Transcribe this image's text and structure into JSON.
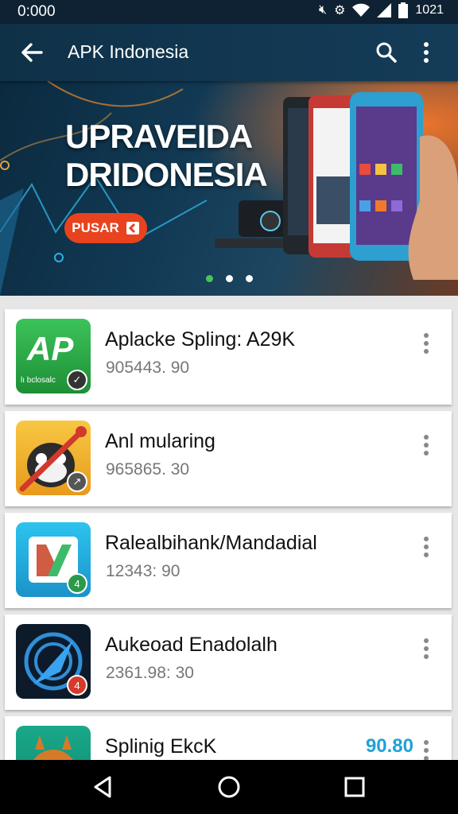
{
  "status_bar": {
    "time": "0:000",
    "icons": [
      "silent-icon",
      "settings-icon",
      "wifi-icon",
      "signal-icon",
      "battery-icon"
    ],
    "clock": "1021"
  },
  "app_bar": {
    "title": "APK Indonesia",
    "icons": [
      "back-arrow-icon",
      "search-icon",
      "more-vert-icon"
    ]
  },
  "banner": {
    "headline_line1": "UPRAVEIDA",
    "headline_line2": "DRIDONESIA",
    "cta_label": "PUSAR",
    "page_indicator": {
      "count": 3,
      "active": 1
    }
  },
  "apps": [
    {
      "name": "Aplacke Spling: A29K",
      "meta": "905443. 90",
      "price": "",
      "icon_text": "AP",
      "icon_sub": "lı bclosalc",
      "badge": "clock"
    },
    {
      "name": "Anl mularing",
      "meta": "965865. 30",
      "price": "",
      "icon_text": "",
      "badge": "arrow"
    },
    {
      "name": "Ralealbihank/Mandadial",
      "meta": "12343: 90",
      "price": "",
      "icon_text": "",
      "badge": "4"
    },
    {
      "name": "Aukeoad Enadolalh",
      "meta": "2361.98: 30",
      "price": "",
      "icon_text": "",
      "badge": "4"
    },
    {
      "name": "Splinig EkcK",
      "meta": "",
      "price": "90.80",
      "icon_text": "",
      "badge": ""
    }
  ],
  "colors": {
    "app_bar": "#143c58",
    "cta": "#e8431e",
    "price": "#1fa2d6",
    "active_dot": "#4cc35a"
  }
}
